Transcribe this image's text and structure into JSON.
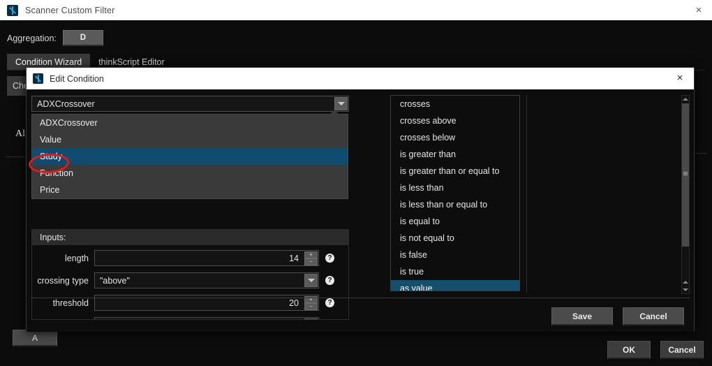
{
  "window": {
    "title": "Scanner Custom Filter",
    "icon": "app-icon",
    "close_label": "×"
  },
  "aggregation": {
    "label": "Aggregation:",
    "value": "D"
  },
  "tabs": [
    {
      "label": "Condition Wizard",
      "active": true
    },
    {
      "label": "thinkScript Editor",
      "active": false
    }
  ],
  "background": {
    "check_label": "Che",
    "all_label": "Al",
    "add_button": "A"
  },
  "window_buttons": {
    "ok": "OK",
    "cancel": "Cancel"
  },
  "dialog": {
    "title": "Edit Condition",
    "icon": "dialog-icon",
    "close_label": "×",
    "combo": {
      "value": "ADXCrossover",
      "arrow_icon": "chevron-down-icon",
      "options": [
        {
          "label": "ADXCrossover",
          "selected": false
        },
        {
          "label": "Value",
          "selected": false
        },
        {
          "label": "Study",
          "selected": true
        },
        {
          "label": "Function",
          "selected": false
        },
        {
          "label": "Price",
          "selected": false
        }
      ]
    },
    "inputs": {
      "header": "Inputs:",
      "rows": [
        {
          "label": "length",
          "value": "14",
          "type": "spinner",
          "help": "?"
        },
        {
          "label": "crossing type",
          "value": "\"above\"",
          "type": "dropdown",
          "help": "?"
        },
        {
          "label": "threshold",
          "value": "20",
          "type": "spinner",
          "help": "?"
        }
      ]
    },
    "operators": [
      {
        "label": "crosses",
        "selected": false
      },
      {
        "label": "crosses above",
        "selected": false
      },
      {
        "label": "crosses below",
        "selected": false
      },
      {
        "label": "is greater than",
        "selected": false
      },
      {
        "label": "is greater than or equal to",
        "selected": false
      },
      {
        "label": "is less than",
        "selected": false
      },
      {
        "label": "is less than or equal to",
        "selected": false
      },
      {
        "label": "is equal to",
        "selected": false
      },
      {
        "label": "is not equal to",
        "selected": false
      },
      {
        "label": "is false",
        "selected": false
      },
      {
        "label": "is true",
        "selected": false
      },
      {
        "label": "as value",
        "selected": true
      }
    ],
    "buttons": {
      "save": "Save",
      "cancel": "Cancel"
    }
  },
  "annotation": {
    "shape": "ellipse",
    "color": "#e01b1b",
    "targets": "Study"
  },
  "colors": {
    "accent_selected": "#14506e",
    "dropdown_selected": "#0f4c70",
    "annotation_red": "#e01b1b",
    "titlebar_bg": "#ffffff",
    "app_bg": "#0c0c0c"
  }
}
